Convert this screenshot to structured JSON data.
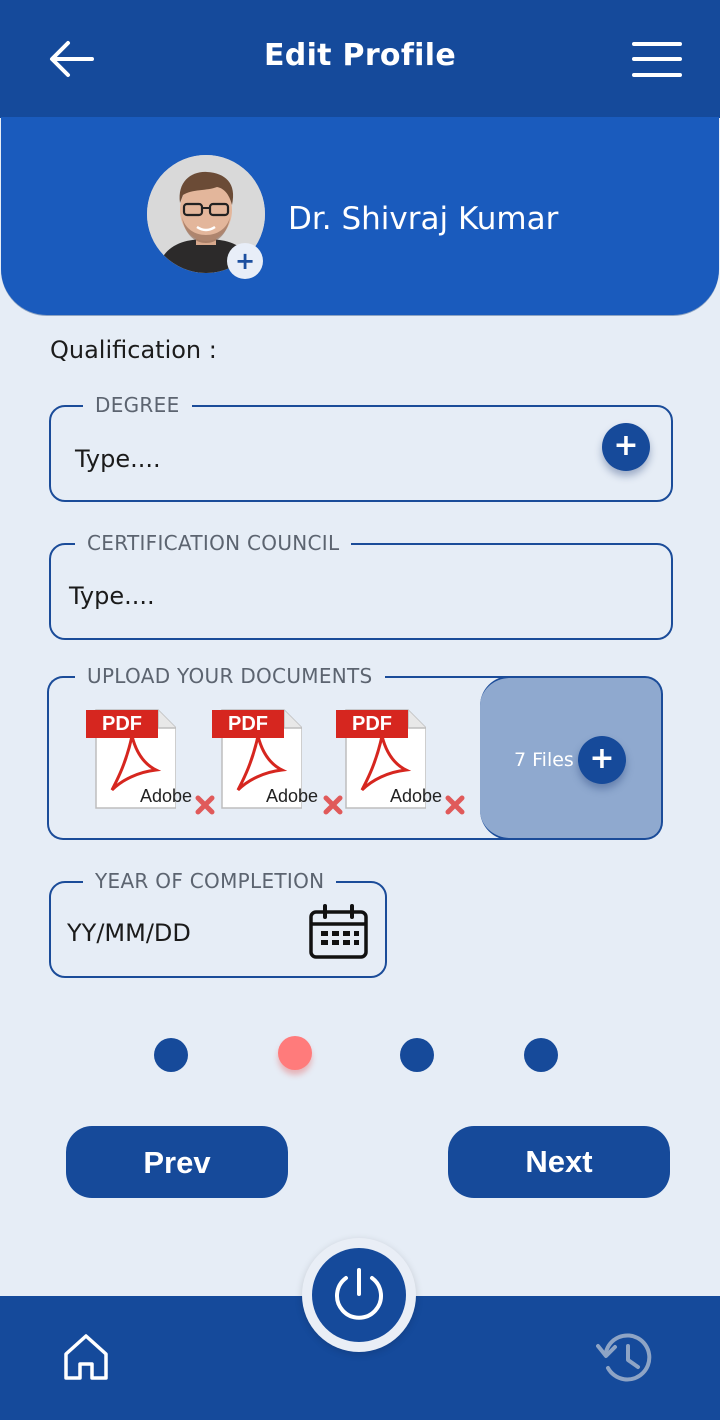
{
  "header": {
    "title": "Edit Profile",
    "back_icon": "arrow-left-icon",
    "menu_icon": "hamburger-menu-icon"
  },
  "profile": {
    "name": "Dr. Shivraj Kumar",
    "avatar_add_label": "+"
  },
  "form": {
    "section_label": "Qualification :",
    "degree": {
      "label": "DEGREE",
      "placeholder": "Type....",
      "add_label": "+"
    },
    "certification": {
      "label": "CERTIFICATION COUNCIL",
      "placeholder": "Type...."
    },
    "documents": {
      "label": "UPLOAD YOUR DOCUMENTS",
      "files": [
        {
          "badge": "PDF",
          "brand": "Adobe"
        },
        {
          "badge": "PDF",
          "brand": "Adobe"
        },
        {
          "badge": "PDF",
          "brand": "Adobe"
        }
      ],
      "files_count_label": "7 Files",
      "add_label": "+"
    },
    "year": {
      "label": "YEAR OF COMPLETION",
      "placeholder": "YY/MM/DD"
    }
  },
  "pager": {
    "total": 4,
    "active_index": 1
  },
  "actions": {
    "prev_label": "Prev",
    "next_label": "Next"
  },
  "bottom_nav": {
    "home_icon": "home-icon",
    "power_icon": "power-icon",
    "history_icon": "history-icon"
  },
  "colors": {
    "primary": "#154a9b",
    "panel": "#1a5bbd",
    "background": "#e6edf6",
    "active_dot": "#ff7b7b",
    "remove": "#e05a5a",
    "pdf_red": "#d6261f"
  }
}
